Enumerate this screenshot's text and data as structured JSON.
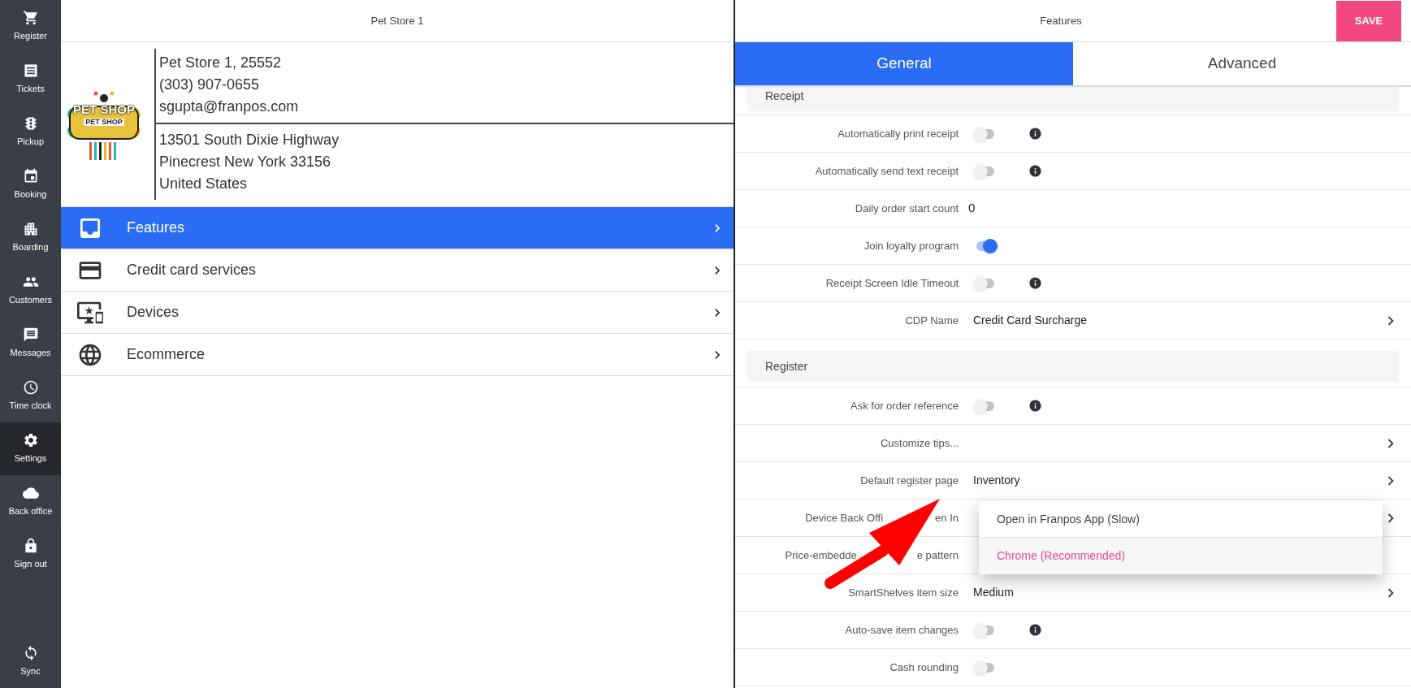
{
  "sidebar": {
    "items": [
      {
        "label": "Register",
        "selected": false
      },
      {
        "label": "Tickets",
        "selected": false
      },
      {
        "label": "Pickup",
        "selected": false
      },
      {
        "label": "Booking",
        "selected": false
      },
      {
        "label": "Boarding",
        "selected": false
      },
      {
        "label": "Customers",
        "selected": false
      },
      {
        "label": "Messages",
        "selected": false
      },
      {
        "label": "Time clock",
        "selected": false
      },
      {
        "label": "Settings",
        "selected": true
      },
      {
        "label": "Back office",
        "selected": false
      },
      {
        "label": "Sign out",
        "selected": false
      }
    ],
    "sync": {
      "label": "Sync"
    }
  },
  "store": {
    "title": "Pet Store 1",
    "logo": {
      "text": "PET SHOP",
      "subtext": "PET SHOP"
    },
    "contact": [
      "Pet Store 1, 25552",
      "(303) 907-0655",
      "sgupta@franpos.com"
    ],
    "address": [
      "13501 South Dixie Highway",
      "Pinecrest New York 33156",
      "United States"
    ]
  },
  "menu": [
    {
      "label": "Features",
      "selected": true
    },
    {
      "label": "Credit card services",
      "selected": false
    },
    {
      "label": "Devices",
      "selected": false
    },
    {
      "label": "Ecommerce",
      "selected": false
    }
  ],
  "features": {
    "title": "Features",
    "save": "SAVE",
    "tabs": [
      {
        "label": "General",
        "selected": true
      },
      {
        "label": "Advanced",
        "selected": false
      }
    ],
    "sections": [
      {
        "title": "Receipt",
        "rows": [
          {
            "kind": "toggle",
            "label": [
              "Automatically print receipt"
            ],
            "on": false,
            "info": true
          },
          {
            "kind": "toggle",
            "label": [
              "Automatically send text receipt"
            ],
            "on": false,
            "info": true
          },
          {
            "kind": "number",
            "label": [
              "Daily order start count"
            ],
            "value": "0"
          },
          {
            "kind": "toggle",
            "label": [
              "Join loyalty program"
            ],
            "on": true,
            "info": false
          },
          {
            "kind": "toggle",
            "label": [
              "Receipt Screen Idle Timeout"
            ],
            "on": false,
            "info": true
          },
          {
            "kind": "select",
            "label": [
              "CDP Name"
            ],
            "value": "Credit Card Surcharge",
            "chevron": true
          }
        ]
      },
      {
        "title": "Register",
        "rows": [
          {
            "kind": "toggle",
            "label": [
              "Ask for order reference"
            ],
            "on": false,
            "info": true
          },
          {
            "kind": "select",
            "label": [
              "Customize tips..."
            ],
            "chevron": true
          },
          {
            "kind": "select",
            "label": [
              "Default register page"
            ],
            "value": "Inventory",
            "chevron": true
          },
          {
            "kind": "select",
            "label": [
              "Device Back Offi",
              "en In"
            ],
            "chevron": true
          },
          {
            "kind": "select",
            "label": [
              "Price-embedde",
              "e pattern"
            ],
            "chevron": false
          },
          {
            "kind": "select",
            "label": [
              "SmartShelves item size"
            ],
            "value": "Medium",
            "chevron": true
          },
          {
            "kind": "toggle",
            "label": [
              "Auto-save item changes"
            ],
            "on": false,
            "info": true
          },
          {
            "kind": "toggle",
            "label": [
              "Cash rounding"
            ],
            "on": false,
            "info": false
          }
        ]
      }
    ],
    "dropdown": [
      {
        "label": "Open in Franpos App (Slow)",
        "selected": false
      },
      {
        "label": "Chrome (Recommended)",
        "selected": true
      }
    ]
  }
}
